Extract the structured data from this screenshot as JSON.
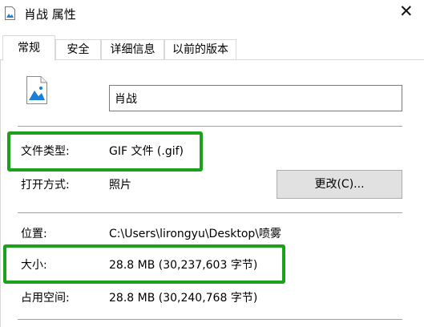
{
  "window": {
    "title": "肖战 属性",
    "close_glyph": "✕"
  },
  "tabs": [
    {
      "label": "常规",
      "active": true
    },
    {
      "label": "安全",
      "active": false
    },
    {
      "label": "详细信息",
      "active": false
    },
    {
      "label": "以前的版本",
      "active": false
    }
  ],
  "file": {
    "icon": "image-file-icon",
    "name": "肖战"
  },
  "properties": {
    "type_label": "文件类型:",
    "type_value": "GIF 文件 (.gif)",
    "opens_with_label": "打开方式:",
    "opens_with_value": "照片",
    "change_button": "更改(C)...",
    "location_label": "位置:",
    "location_value": "C:\\Users\\lirongyu\\Desktop\\喷雾",
    "size_label": "大小:",
    "size_value": "28.8 MB (30,237,603 字节)",
    "size_on_disk_label": "占用空间:",
    "size_on_disk_value": "28.8 MB (30,240,768 字节)"
  },
  "colors": {
    "highlight": "#1ca21a",
    "icon_blue": "#1b7fd6"
  }
}
